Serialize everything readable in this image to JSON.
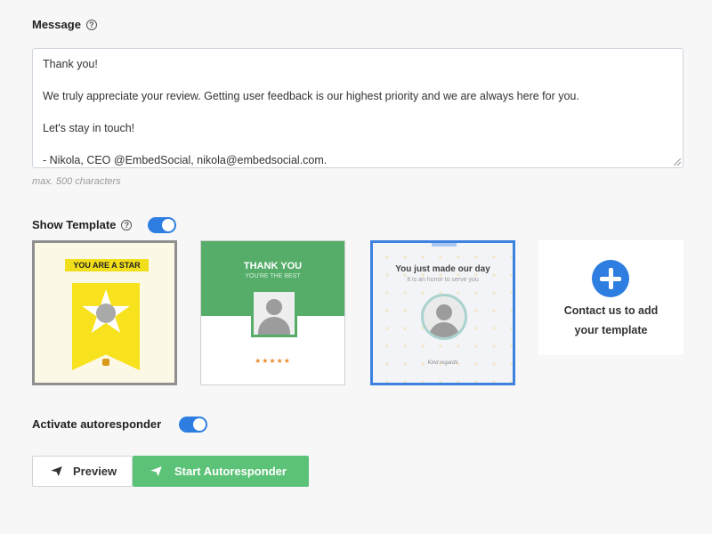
{
  "message": {
    "label": "Message",
    "help": "?",
    "text_lines": [
      "Thank you!",
      "",
      "We truly appreciate your review. Getting user feedback is our highest priority and we are always here for you.",
      "",
      "Let's stay in touch!",
      "",
      "- Nikola, CEO @EmbedSocial, nikola@embedsocial.com."
    ],
    "hint": "max. 500 characters"
  },
  "show_template": {
    "label": "Show Template",
    "help": "?",
    "enabled": true
  },
  "templates": {
    "t1": {
      "ribbon": "YOU ARE A STAR"
    },
    "t2": {
      "title": "THANK YOU",
      "subtitle": "YOU'RE THE BEST",
      "stars": "★★★★★"
    },
    "t3": {
      "title": "You just made our day",
      "subtitle": "It is an honor to serve you",
      "signature": "Kind regards"
    },
    "t4": {
      "text": "Contact us to add\nyour template"
    }
  },
  "autoresponder": {
    "label": "Activate autoresponder",
    "enabled": true
  },
  "buttons": {
    "preview": "Preview",
    "start": "Start Autoresponder"
  },
  "colors": {
    "accent_blue": "#2d7ee0",
    "start_green": "#5cc277",
    "template_green": "#56ad6a"
  }
}
